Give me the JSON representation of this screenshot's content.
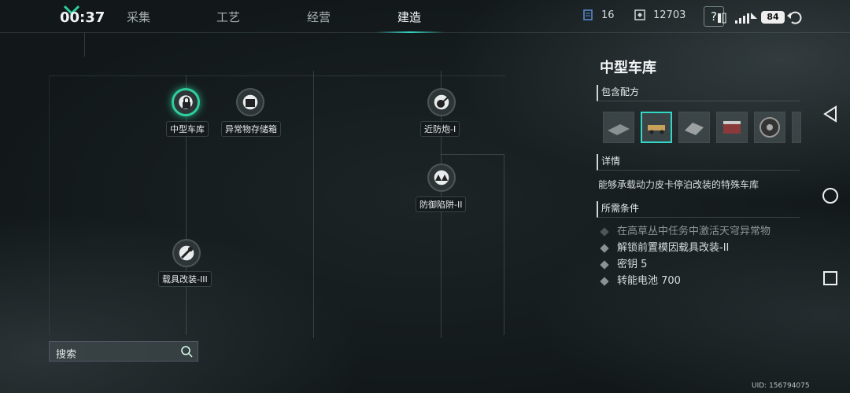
{
  "status_bar": {
    "time": "00:37",
    "battery": "84"
  },
  "tabs": [
    {
      "label": "采集",
      "active": false
    },
    {
      "label": "工艺",
      "active": false
    },
    {
      "label": "经营",
      "active": false
    },
    {
      "label": "建造",
      "active": true
    }
  ],
  "resources": {
    "keys": "16",
    "currency": "12703"
  },
  "help": {
    "label": "?"
  },
  "tree": {
    "nodes": [
      {
        "label": "中型车库",
        "active": true
      },
      {
        "label": "异常物存储箱",
        "active": false
      },
      {
        "label": "近防炮-I",
        "active": false
      },
      {
        "label": "防御陷阱-II",
        "active": false
      },
      {
        "label": "载具改装-III",
        "active": false
      }
    ]
  },
  "search": {
    "placeholder": "搜索"
  },
  "panel": {
    "title": "中型车库",
    "recipes_header": "包含配方",
    "details_header": "详情",
    "details_text": "能够承载动力皮卡停泊改装的特殊车库",
    "requirements_header": "所需条件",
    "requirements": [
      {
        "text": "在高草丛中任务中激活天穹异常物",
        "met": false
      },
      {
        "text": "解锁前置模因载具改装-II",
        "met": true
      },
      {
        "text": "密钥 5",
        "met": true
      },
      {
        "text": "转能电池 700",
        "met": true
      }
    ]
  },
  "uid": "UID: 156794075",
  "colors": {
    "accent": "#32d8c6",
    "active_node": "#2fcf9b",
    "background": "#161c1e"
  }
}
